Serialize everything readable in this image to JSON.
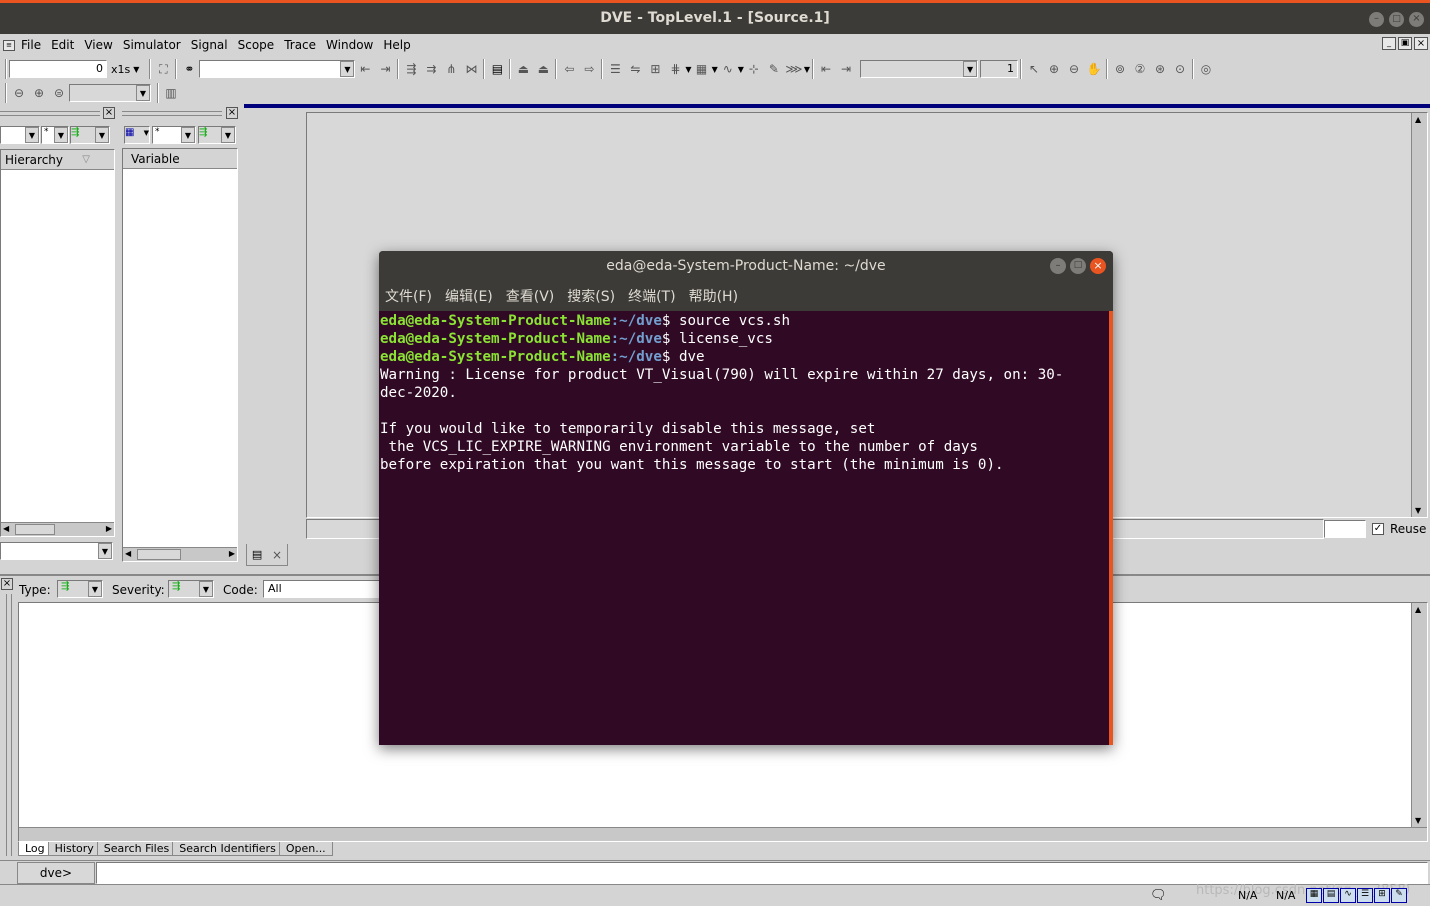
{
  "window": {
    "title": "DVE - TopLevel.1 - [Source.1]"
  },
  "menubar": {
    "items": [
      "File",
      "Edit",
      "View",
      "Simulator",
      "Signal",
      "Scope",
      "Trace",
      "Window",
      "Help"
    ]
  },
  "toolbar": {
    "time_value": "0",
    "time_unit": "x1s",
    "page_value": "1"
  },
  "hierarchy_panel": {
    "filter": "*",
    "header": "Hierarchy"
  },
  "variable_panel": {
    "filter": "*",
    "header": "Variable"
  },
  "source_panel": {
    "reuse_label": "Reuse",
    "reuse_checked": true
  },
  "console": {
    "type_label": "Type:",
    "severity_label": "Severity:",
    "code_label": "Code:",
    "code_value": "All",
    "tabs": [
      "Log",
      "History",
      "Search Files",
      "Search Identifiers",
      "Open..."
    ],
    "prompt": "dve>"
  },
  "statusbar": {
    "na1": "N/A",
    "na2": "N/A",
    "watermark": "https://blog.csdn.net/qq_..._9020"
  },
  "terminal": {
    "title": "eda@eda-System-Product-Name: ~/dve",
    "menu": [
      "文件(F)",
      "编辑(E)",
      "查看(V)",
      "搜索(S)",
      "终端(T)",
      "帮助(H)"
    ],
    "user_host": "eda@eda-System-Product-Name",
    "path": ":~/dve",
    "commands": [
      "source vcs.sh",
      "license_vcs",
      "dve"
    ],
    "output": [
      "Warning : License for product VT_Visual(790) will expire within 27 days, on: 30-",
      "dec-2020.",
      "",
      "If you would like to temporarily disable this message, set",
      " the VCS_LIC_EXPIRE_WARNING environment variable to the number of days",
      "before expiration that you want this message to start (the minimum is 0)."
    ]
  },
  "colors": {
    "terminal_bg": "#300a24",
    "prompt_green": "#8ae234",
    "path_blue": "#729fcf",
    "accent_orange": "#e95420"
  }
}
